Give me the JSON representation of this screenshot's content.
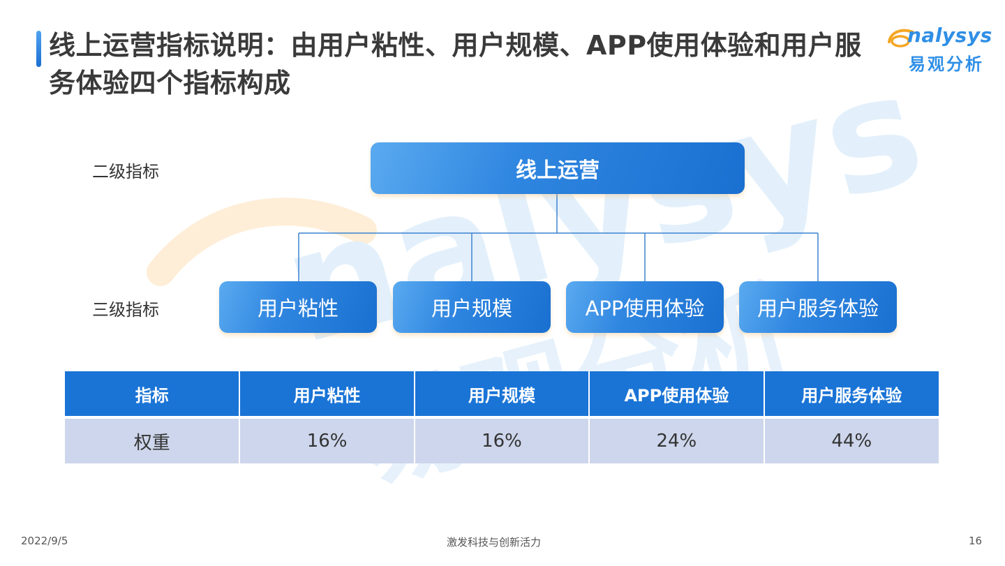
{
  "header": {
    "title": "线上运营指标说明：由用户粘性、用户规模、APP使用体验和用户服务体验四个指标构成"
  },
  "logo": {
    "text_en": "nalysys",
    "text_cn": "易观分析",
    "brand_color": "#2f8fe6",
    "accent_color": "#f5a623"
  },
  "diagram": {
    "level_labels": [
      "二级指标",
      "三级指标"
    ],
    "root": "线上运营",
    "children": [
      "用户粘性",
      "用户规模",
      "APP使用体验",
      "用户服务体验"
    ],
    "node_color": "#1a70d0",
    "connector_color": "#3c82d0"
  },
  "table": {
    "headers": [
      "指标",
      "用户粘性",
      "用户规模",
      "APP使用体验",
      "用户服务体验"
    ],
    "rows": [
      [
        "权重",
        "16%",
        "16%",
        "24%",
        "44%"
      ]
    ],
    "header_color": "#1a74d6",
    "row_color": "#cdd6ec"
  },
  "footer": {
    "date": "2022/9/5",
    "slogan": "激发科技与创新活力",
    "page": "16"
  }
}
